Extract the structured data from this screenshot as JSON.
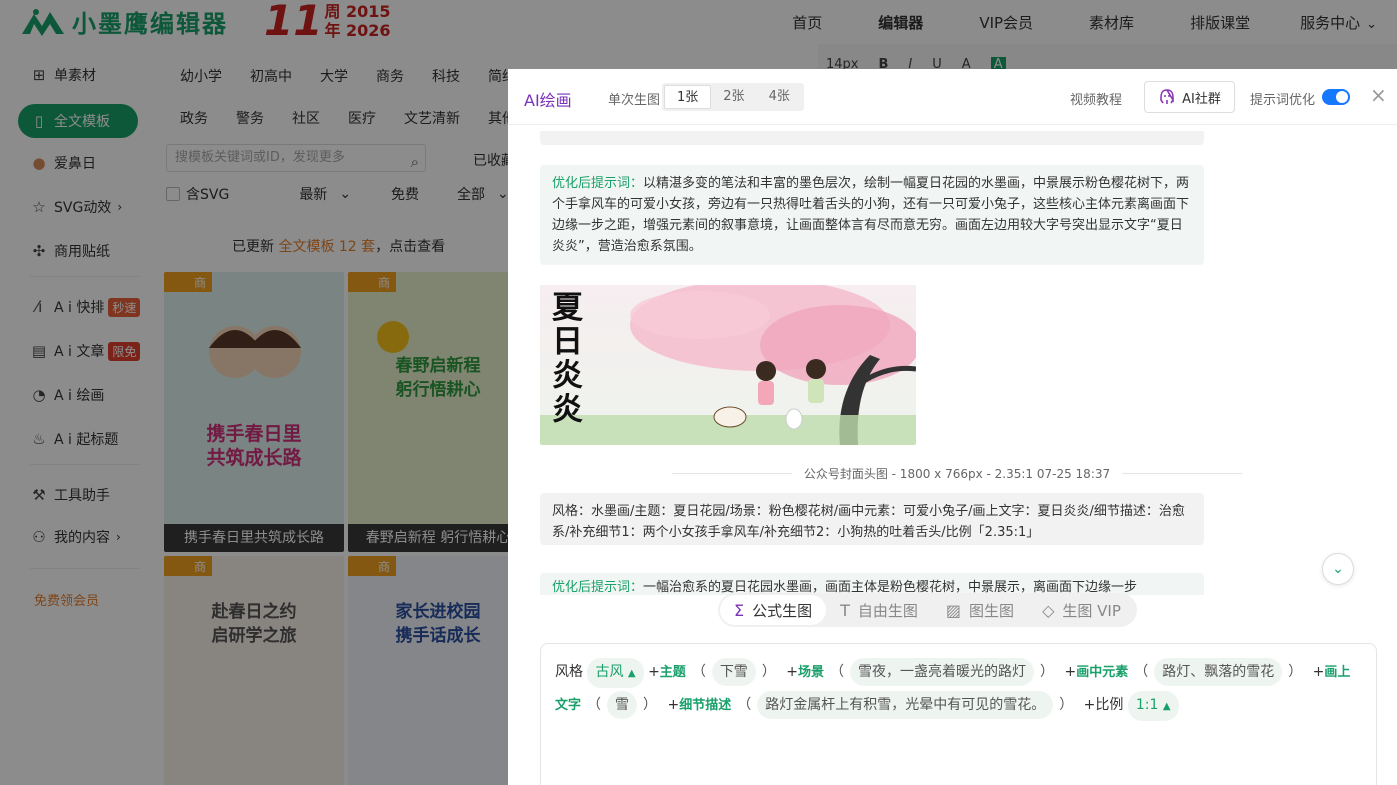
{
  "topbar": {
    "logo_text": "小墨鹰编辑器",
    "anniv_num": "11",
    "anniv_top": "周 2015",
    "anniv_bottom": "年 2026",
    "nav": [
      "首页",
      "编辑器",
      "VIP会员",
      "素材库",
      "排版课堂",
      "服务中心"
    ]
  },
  "sidebar": {
    "items": [
      {
        "label": "单素材",
        "icon": "grid-icon"
      },
      {
        "label": "全文模板",
        "icon": "template-icon"
      },
      {
        "label": "爱鼻日",
        "icon": "person-icon"
      },
      {
        "label": "SVG动效",
        "icon": "star-icon"
      },
      {
        "label": "商用贴纸",
        "icon": "puzzle-icon"
      },
      {
        "label": "A i 快排",
        "icon": "ai-icon",
        "badge": "秒速"
      },
      {
        "label": "A i 文章",
        "icon": "doc-icon",
        "badge": "限免"
      },
      {
        "label": "A i 绘画",
        "icon": "palette-icon"
      },
      {
        "label": "A i 起标题",
        "icon": "flame-icon"
      },
      {
        "label": "工具助手",
        "icon": "tools-icon"
      },
      {
        "label": "我的内容",
        "icon": "user-icon"
      }
    ],
    "free_vip": "免费领会员"
  },
  "main": {
    "cat_row1": [
      "幼小学",
      "初高中",
      "大学",
      "商务",
      "科技",
      "简约"
    ],
    "cat_row2": [
      "政务",
      "警务",
      "社区",
      "医疗",
      "文艺清新",
      "其他"
    ],
    "search_placeholder": "搜模板关键词或ID，发现更多",
    "saved": "已收藏",
    "filter_svg": "含SVG",
    "filter_sort": "最新",
    "filter_free": "免费",
    "filter_all": "全部",
    "update_prefix": "已更新 ",
    "update_hl": "全文模板 12 套",
    "update_suffix": "，点击查看",
    "cards": [
      {
        "corner": "商",
        "title": "携手春日里\n共筑成长路",
        "caption": "携手春日里共筑成长路"
      },
      {
        "corner": "商",
        "title": "春野启新程\n躬行悟耕心",
        "caption": "春野启新程 躬行悟耕心"
      },
      {
        "corner": "商",
        "title": "赴春日之约\n启研学之旅",
        "caption": ""
      },
      {
        "corner": "商",
        "title": "家长进校园\n携手话成长",
        "caption": ""
      }
    ]
  },
  "toolbar_peek": [
    "14px",
    "B",
    "I",
    "U",
    "A",
    "A"
  ],
  "panel": {
    "title": "AI绘画",
    "gen_label": "单次生图",
    "gen_options": [
      "1张",
      "2张",
      "4张"
    ],
    "video_link": "视频教程",
    "ai_group": "AI社群",
    "opt_label": "提示词优化",
    "msg1_tag": "优化后提示词：",
    "msg1_text": "以精湛多变的笔法和丰富的墨色层次，绘制一幅夏日花园的水墨画，中景展示粉色樱花树下，两个手拿风车的可爱小女孩，旁边有一只热得吐着舌头的小狗，还有一只可爱小兔子，这些核心主体元素离画面下边缘一步之距，增强元素间的叙事意境，让画面整体言有尽而意无穷。画面左边用较大字号突出显示文字“夏日炎炎”，营造治愈系氛围。",
    "img_text": "夏日炎炎",
    "img_meta": "公众号封面头图 - 1800 x 766px - 2.35:1    07-25 18:37",
    "msg2_text": "风格：水墨画/主题：夏日花园/场景：粉色樱花树/画中元素：可爱小兔子/画上文字：夏日炎炎/细节描述：治愈系/补充细节1：两个小女孩手拿风车/补充细节2：小狗热的吐着舌头/比例「2.35:1」",
    "msg3_tag": "优化后提示词：",
    "msg3_text": "一幅治愈系的夏日花园水墨画，画面主体是粉色樱花树，中景展示，离画面下边缘一步",
    "mode_tabs": [
      "公式生图",
      "自由生图",
      "图生图",
      "生图 VIP"
    ],
    "formula": {
      "style_label": "风格",
      "style_value": "古风",
      "theme_label": "主题",
      "theme_value": "下雪",
      "scene_label": "场景",
      "scene_value": "雪夜，一盏亮着暖光的路灯",
      "elem_label": "画中元素",
      "elem_value": "路灯、飘落的雪花",
      "text_label": "画上文字",
      "text_value": "雪",
      "detail_label": "细节描述",
      "detail_value": "路灯金属杆上有积雪，光晕中有可见的雪花。",
      "ratio_label": "比例",
      "ratio_value": "1:1"
    }
  }
}
